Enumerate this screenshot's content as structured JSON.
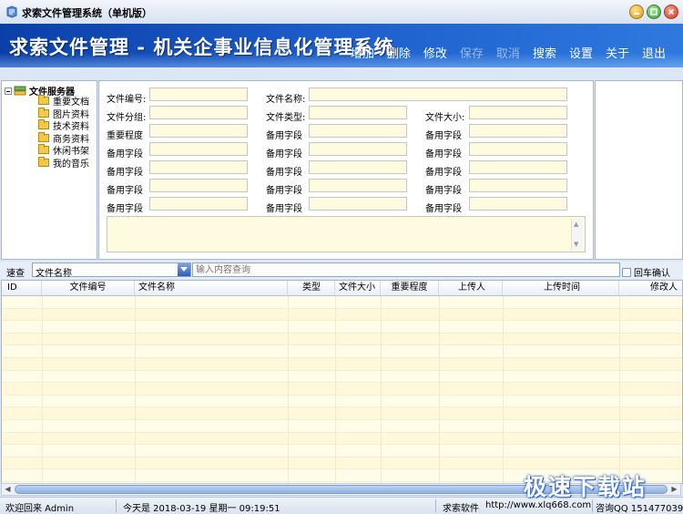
{
  "window": {
    "title": "求索文件管理系统（单机版）"
  },
  "banner": {
    "title": "求索文件管理 - 机关企事业信息化管理系统"
  },
  "toolbar": {
    "items": [
      {
        "label": "增加",
        "enabled": true
      },
      {
        "label": "删除",
        "enabled": true
      },
      {
        "label": "修改",
        "enabled": true
      },
      {
        "label": "保存",
        "enabled": false
      },
      {
        "label": "取消",
        "enabled": false
      },
      {
        "label": "搜索",
        "enabled": true
      },
      {
        "label": "设置",
        "enabled": true
      },
      {
        "label": "关于",
        "enabled": true
      },
      {
        "label": "退出",
        "enabled": true
      }
    ]
  },
  "tree": {
    "root": "文件服务器",
    "items": [
      "重要文档",
      "图片资料",
      "技术资料",
      "商务资料",
      "休闲书架",
      "我的音乐"
    ]
  },
  "form": {
    "file_no": "文件编号:",
    "file_name": "文件名称:",
    "file_group": "文件分组:",
    "file_type": "文件类型:",
    "file_size": "文件大小:",
    "importance": "重要程度",
    "spare": "备用字段"
  },
  "search": {
    "label": "速查",
    "field": "文件名称",
    "placeholder": "输入内容查询",
    "enter_confirm": "回车确认"
  },
  "grid": {
    "columns": [
      "ID",
      "文件编号",
      "文件名称",
      "类型",
      "文件大小",
      "重要程度",
      "上传人",
      "上传时间",
      "修改人"
    ]
  },
  "status": {
    "welcome": "欢迎回来 Admin",
    "date": "今天是 2018-03-19 星期一 09:19:51",
    "company": "求索软件",
    "url": "http://www.xlq668.com",
    "qq": "咨询QQ 151477039"
  },
  "watermark": "极速下载站",
  "colors": {
    "banner": "#1d5fcc",
    "input_bg": "#fffbe0",
    "grid_row": "#fffce8"
  }
}
